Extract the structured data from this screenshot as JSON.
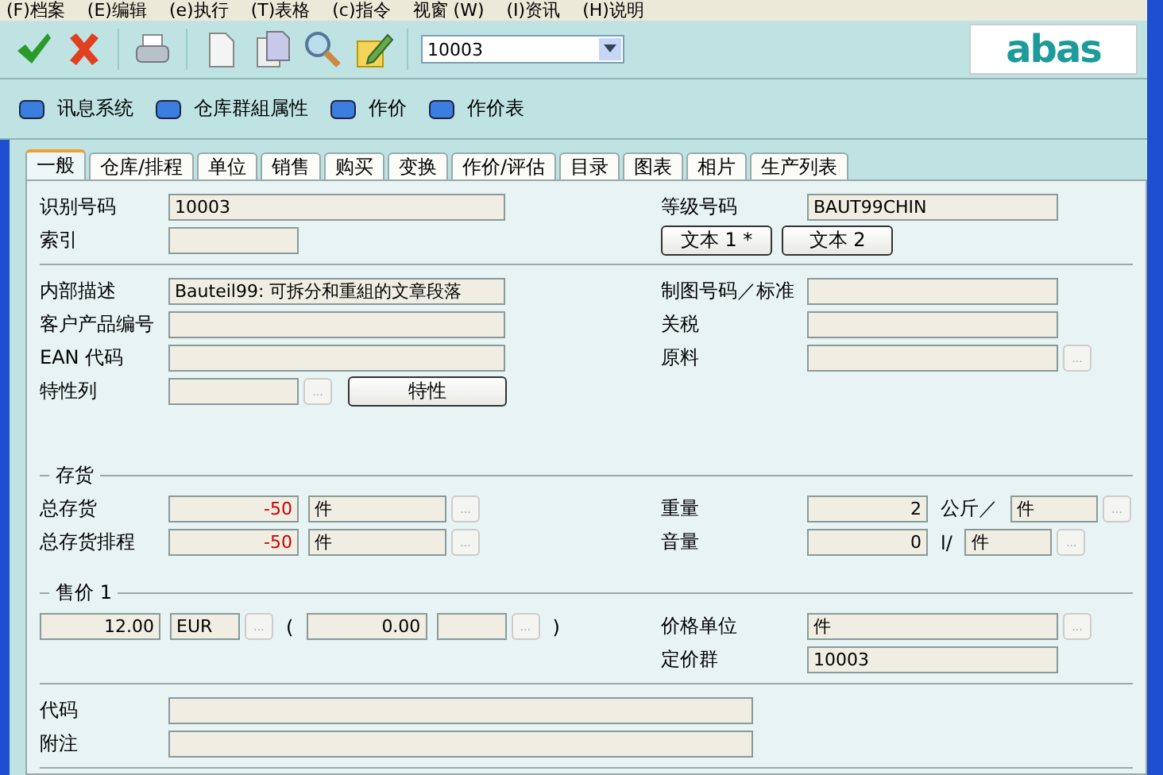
{
  "menu": [
    "(F)档案",
    "(E)编辑",
    "(e)执行",
    "(T)表格",
    "(c)指令",
    "视窗 (W)",
    "(I)资讯",
    "(H)说明"
  ],
  "toolbar": {
    "combo_value": "10003",
    "logo": "abas"
  },
  "links": [
    "讯息系统",
    "仓库群組属性",
    "作价",
    "作价表"
  ],
  "tabs": [
    {
      "label": "一般",
      "selected": true
    },
    {
      "label": "仓库/排程",
      "selected": false
    },
    {
      "label": "单位",
      "selected": false
    },
    {
      "label": "销售",
      "selected": false
    },
    {
      "label": "购买",
      "selected": false
    },
    {
      "label": "变换",
      "selected": false
    },
    {
      "label": "作价/评估",
      "selected": false
    },
    {
      "label": "目录",
      "selected": false
    },
    {
      "label": "图表",
      "selected": false
    },
    {
      "label": "相片",
      "selected": false
    },
    {
      "label": "生产列表",
      "selected": false
    }
  ],
  "sections": [
    {
      "rows": [
        {
          "left": {
            "label": "识别号码",
            "items": [
              {
                "kind": "field",
                "value": "10003"
              }
            ]
          },
          "right": {
            "label": "等级号码",
            "items": [
              {
                "kind": "field",
                "value": "BAUT99CHIN"
              }
            ]
          }
        },
        {
          "left": {
            "label": "索引",
            "items": [
              {
                "kind": "field"
              }
            ]
          },
          "right": {
            "items": [
              {
                "kind": "button",
                "label": "文本 1 *"
              },
              {
                "kind": "button",
                "label": "文本 2"
              }
            ]
          }
        }
      ]
    },
    {
      "rows": [
        {
          "left": {
            "label": "内部描述",
            "items": [
              {
                "kind": "field",
                "value": "Bauteil99: 可拆分和重組的文章段落"
              }
            ]
          },
          "right": {
            "label": "制图号码／标准",
            "items": [
              {
                "kind": "field"
              }
            ]
          }
        },
        {
          "left": {
            "label": "客户产品编号",
            "items": [
              {
                "kind": "field"
              }
            ]
          },
          "right": {
            "label": "关税",
            "items": [
              {
                "kind": "field"
              }
            ]
          }
        },
        {
          "left": {
            "label": "EAN 代码",
            "items": [
              {
                "kind": "field"
              }
            ]
          },
          "right": {
            "label": "原料",
            "items": [
              {
                "kind": "field"
              },
              {
                "kind": "lookup",
                "label": "..."
              }
            ]
          }
        },
        {
          "left": {
            "label": "特性列",
            "items": [
              {
                "kind": "field"
              },
              {
                "kind": "lookup",
                "label": "..."
              },
              {
                "kind": "button",
                "label": "特性"
              }
            ]
          }
        }
      ]
    },
    {
      "title": "存货",
      "rows": [
        {
          "left": {
            "label": "总存货",
            "items": [
              {
                "kind": "field",
                "value": "-50",
                "negative": true
              },
              {
                "kind": "field",
                "value": "件"
              },
              {
                "kind": "lookup",
                "label": "..."
              }
            ]
          },
          "right": {
            "label": "重量",
            "items": [
              {
                "kind": "field",
                "value": "2",
                "negative": false
              },
              {
                "kind": "text",
                "value": "公斤／"
              },
              {
                "kind": "field",
                "value": "件"
              },
              {
                "kind": "lookup",
                "label": "..."
              }
            ]
          }
        },
        {
          "left": {
            "label": "总存货排程",
            "items": [
              {
                "kind": "field",
                "value": "-50",
                "negative": true
              },
              {
                "kind": "field",
                "value": "件"
              },
              {
                "kind": "lookup",
                "label": "..."
              }
            ]
          },
          "right": {
            "label": "音量",
            "items": [
              {
                "kind": "field",
                "value": "0",
                "negative": false
              },
              {
                "kind": "text",
                "value": "l/"
              },
              {
                "kind": "field",
                "value": "件"
              },
              {
                "kind": "lookup",
                "label": "..."
              }
            ]
          }
        }
      ]
    },
    {
      "title": "售价 1",
      "rows": [
        {
          "left": {
            "items": [
              {
                "kind": "field",
                "value": "12.00",
                "negative": false
              },
              {
                "kind": "field",
                "value": "EUR"
              },
              {
                "kind": "lookup",
                "label": "..."
              },
              {
                "kind": "text",
                "value": "("
              },
              {
                "kind": "field",
                "value": "0.00",
                "negative": false
              },
              {
                "kind": "field"
              },
              {
                "kind": "lookup",
                "label": "..."
              },
              {
                "kind": "text",
                "value": ")"
              }
            ]
          },
          "right": {
            "label": "价格单位",
            "items": [
              {
                "kind": "field",
                "value": "件"
              },
              {
                "kind": "lookup",
                "label": "..."
              }
            ]
          }
        },
        {
          "right": {
            "label": "定价群",
            "items": [
              {
                "kind": "field",
                "value": "10003"
              }
            ]
          }
        }
      ]
    },
    {
      "rows": [
        {
          "left": {
            "label": "代码",
            "items": [
              {
                "kind": "field"
              }
            ]
          }
        },
        {
          "left": {
            "label": "附注",
            "items": [
              {
                "kind": "field"
              }
            ]
          }
        }
      ]
    }
  ]
}
